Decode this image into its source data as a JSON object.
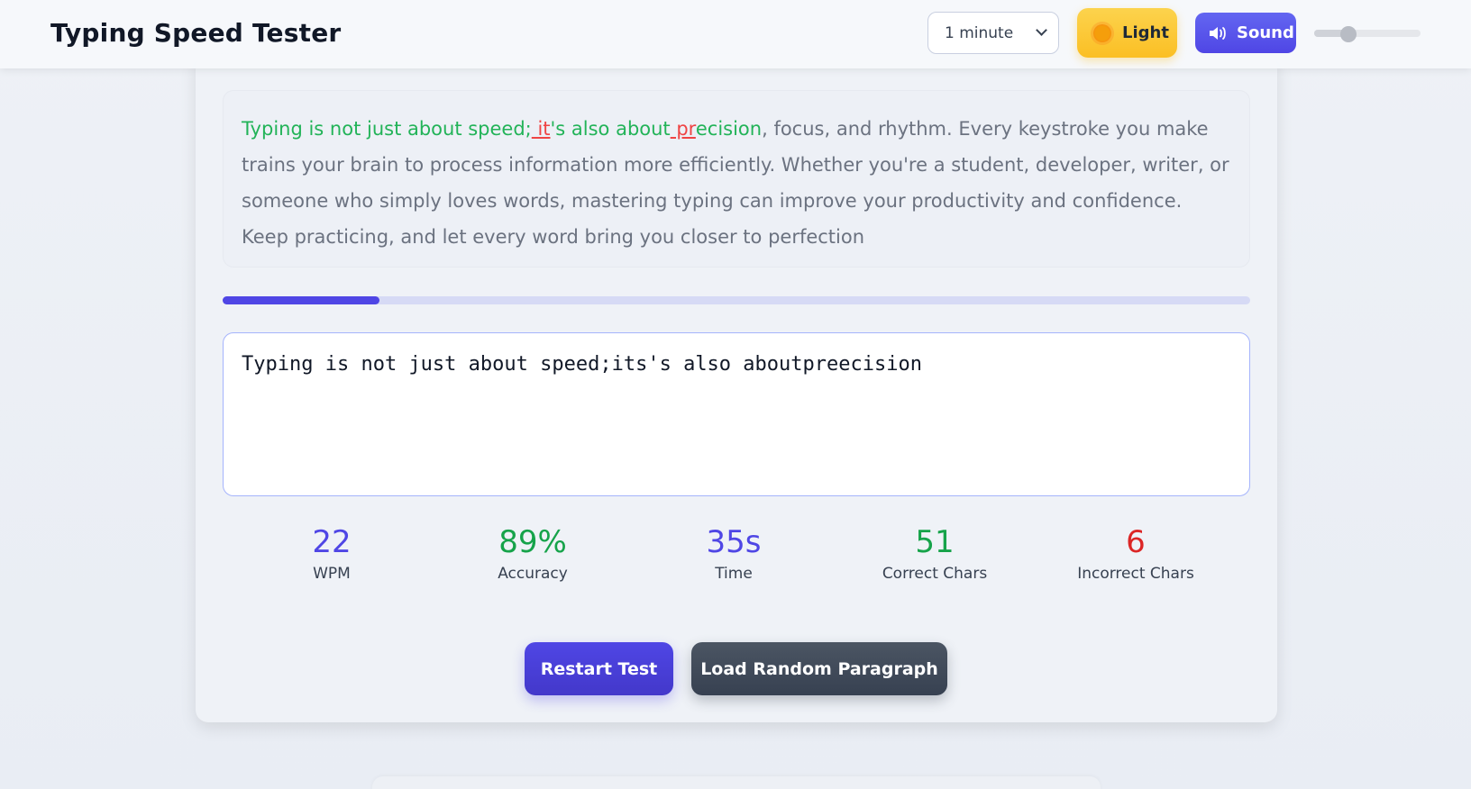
{
  "header": {
    "title": "Typing Speed Tester",
    "duration": {
      "selected": "1 minute"
    },
    "theme_button": {
      "label": "Light",
      "icon": "sun-icon"
    },
    "sound_button": {
      "label": "Sound",
      "icon": "speaker-icon"
    },
    "volume": {
      "level_fraction": 0.32
    }
  },
  "paragraph": {
    "segments": [
      {
        "text": "Typing is not just about speed;",
        "state": "correct"
      },
      {
        "text": " it",
        "state": "incorrect"
      },
      {
        "text": "'s also about",
        "state": "correct"
      },
      {
        "text": " pr",
        "state": "incorrect"
      },
      {
        "text": "ecision",
        "state": "correct"
      },
      {
        "text": ", focus, and rhythm. Every keystroke you make trains your brain to process information more efficiently. Whether you're a student, developer, writer, or someone who simply loves words, mastering typing can improve your productivity and confidence. Keep practicing, and let every word bring you closer to perfection",
        "state": "pending"
      }
    ]
  },
  "progress": {
    "fraction": 0.153
  },
  "input": {
    "value": "Typing is not just about speed;its's also aboutpreecision"
  },
  "stats": [
    {
      "value": "22",
      "label": "WPM",
      "color": "#4f46e5"
    },
    {
      "value": "89%",
      "label": "Accuracy",
      "color": "#16a34a"
    },
    {
      "value": "35s",
      "label": "Time",
      "color": "#4f46e5"
    },
    {
      "value": "51",
      "label": "Correct Chars",
      "color": "#16a34a"
    },
    {
      "value": "6",
      "label": "Incorrect Chars",
      "color": "#dc2626"
    }
  ],
  "actions": {
    "restart_label": "Restart Test",
    "random_label": "Load Random Paragraph"
  },
  "colors": {
    "accent": "#4f46e5",
    "correct": "#22b358",
    "incorrect": "#ef4444",
    "pending": "#6b7280"
  }
}
